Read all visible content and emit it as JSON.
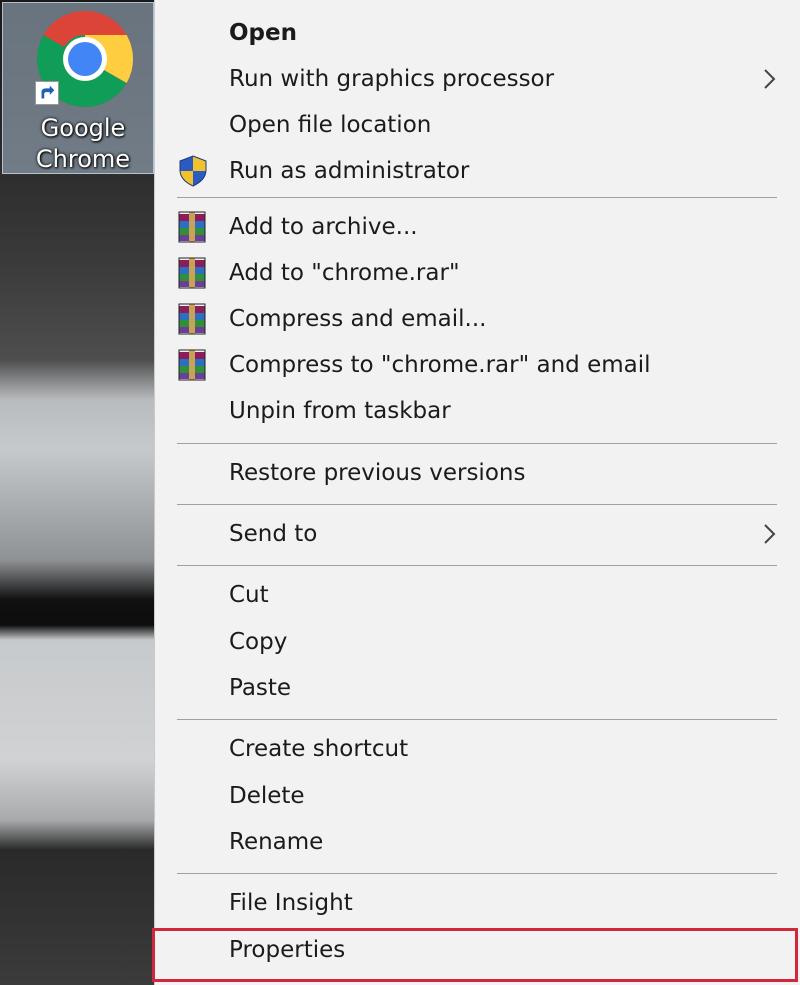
{
  "desktop": {
    "shortcut": {
      "label": "Google\nChrome",
      "icon": "google-chrome-icon"
    }
  },
  "context_menu": {
    "items": [
      {
        "id": "open",
        "label": "Open",
        "bold": true
      },
      {
        "id": "run-with-graphics-processor",
        "label": "Run with graphics processor",
        "submenu": true
      },
      {
        "id": "open-file-location",
        "label": "Open file location"
      },
      {
        "id": "run-as-administrator",
        "label": "Run as administrator",
        "icon": "uac-shield-icon"
      },
      {
        "id": "add-to-archive",
        "label": "Add to archive...",
        "icon": "winrar-icon"
      },
      {
        "id": "add-to-chrome-rar",
        "label": "Add to \"chrome.rar\"",
        "icon": "winrar-icon"
      },
      {
        "id": "compress-and-email",
        "label": "Compress and email...",
        "icon": "winrar-icon"
      },
      {
        "id": "compress-to-chrome-rar-and-email",
        "label": "Compress to \"chrome.rar\" and email",
        "icon": "winrar-icon"
      },
      {
        "id": "unpin-from-taskbar",
        "label": "Unpin from taskbar"
      },
      {
        "id": "restore-previous-versions",
        "label": "Restore previous versions"
      },
      {
        "id": "send-to",
        "label": "Send to",
        "submenu": true
      },
      {
        "id": "cut",
        "label": "Cut"
      },
      {
        "id": "copy",
        "label": "Copy"
      },
      {
        "id": "paste",
        "label": "Paste"
      },
      {
        "id": "create-shortcut",
        "label": "Create shortcut"
      },
      {
        "id": "delete",
        "label": "Delete"
      },
      {
        "id": "rename",
        "label": "Rename"
      },
      {
        "id": "file-insight",
        "label": "File Insight"
      },
      {
        "id": "properties",
        "label": "Properties",
        "highlighted": true
      }
    ]
  },
  "colors": {
    "menu_background": "#f2f2f2",
    "highlight_border": "#d0273a",
    "separator": "#a0a0a0"
  }
}
